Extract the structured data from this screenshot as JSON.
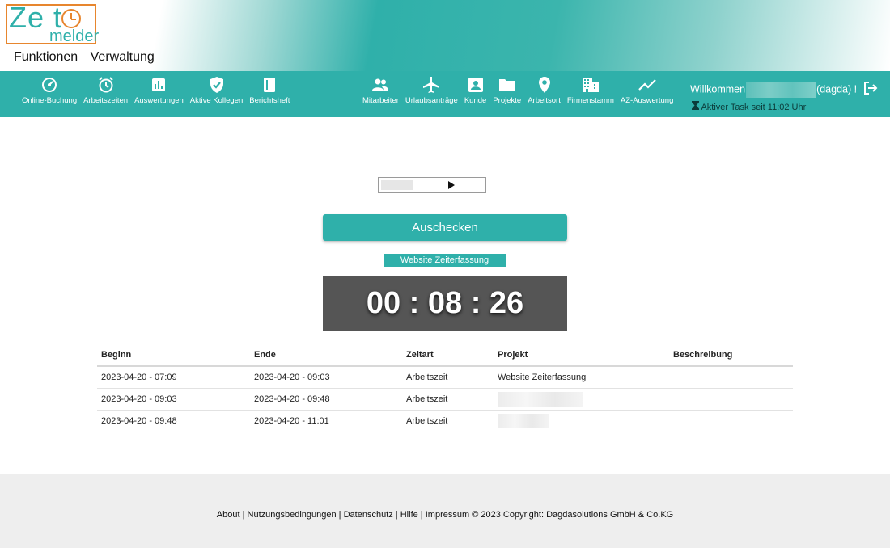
{
  "logo": {
    "line1": "Zeit",
    "line2": "melder"
  },
  "top_menu": [
    "Funktionen",
    "Verwaltung"
  ],
  "nav_left": [
    {
      "label": "Online-Buchung",
      "icon": "dial-icon"
    },
    {
      "label": "Arbeitszeiten",
      "icon": "alarm-clock-icon"
    },
    {
      "label": "Auswertungen",
      "icon": "bar-chart-icon"
    },
    {
      "label": "Aktive Kollegen",
      "icon": "shield-check-icon"
    },
    {
      "label": "Berichtsheft",
      "icon": "book-icon"
    }
  ],
  "nav_right": [
    {
      "label": "Mitarbeiter",
      "icon": "people-icon"
    },
    {
      "label": "Urlaubsanträge",
      "icon": "airplane-icon"
    },
    {
      "label": "Kunde",
      "icon": "contact-card-icon"
    },
    {
      "label": "Projekte",
      "icon": "folder-icon"
    },
    {
      "label": "Arbeitsort",
      "icon": "location-pin-icon"
    },
    {
      "label": "Firmenstamm",
      "icon": "building-icon"
    },
    {
      "label": "AZ-Auswertung",
      "icon": "trend-line-icon"
    }
  ],
  "user": {
    "welcome": "Willkommen",
    "username": "(dagda) !"
  },
  "task": {
    "text": "Aktiver Task seit 11:02 Uhr"
  },
  "checkout_label": "Auschecken",
  "project_badge": "Website Zeiterfassung",
  "timer": "00 : 08 : 26",
  "table": {
    "headers": [
      "Beginn",
      "Ende",
      "Zeitart",
      "Projekt",
      "Beschreibung"
    ],
    "rows": [
      {
        "beginn": "2023-04-20 - 07:09",
        "ende": "2023-04-20 - 09:03",
        "zeitart": "Arbeitszeit",
        "projekt": "Website Zeiterfassung",
        "beschreibung": ""
      },
      {
        "beginn": "2023-04-20 - 09:03",
        "ende": "2023-04-20 - 09:48",
        "zeitart": "Arbeitszeit",
        "projekt": "",
        "beschreibung": ""
      },
      {
        "beginn": "2023-04-20 - 09:48",
        "ende": "2023-04-20 - 11:01",
        "zeitart": "Arbeitszeit",
        "projekt": "",
        "beschreibung": ""
      }
    ]
  },
  "footer": {
    "about": "About",
    "terms": "Nutzungsbedingungen",
    "privacy": "Datenschutz",
    "help": "Hilfe",
    "imprint": "Impressum",
    "copyright": "© 2023 Copyright: Dagdasolutions GmbH & Co.KG"
  },
  "colors": {
    "accent": "#2fb0aa",
    "logo_orange": "#e7862e",
    "timer_bg": "#555555",
    "footer_bg": "#eeeeee"
  }
}
